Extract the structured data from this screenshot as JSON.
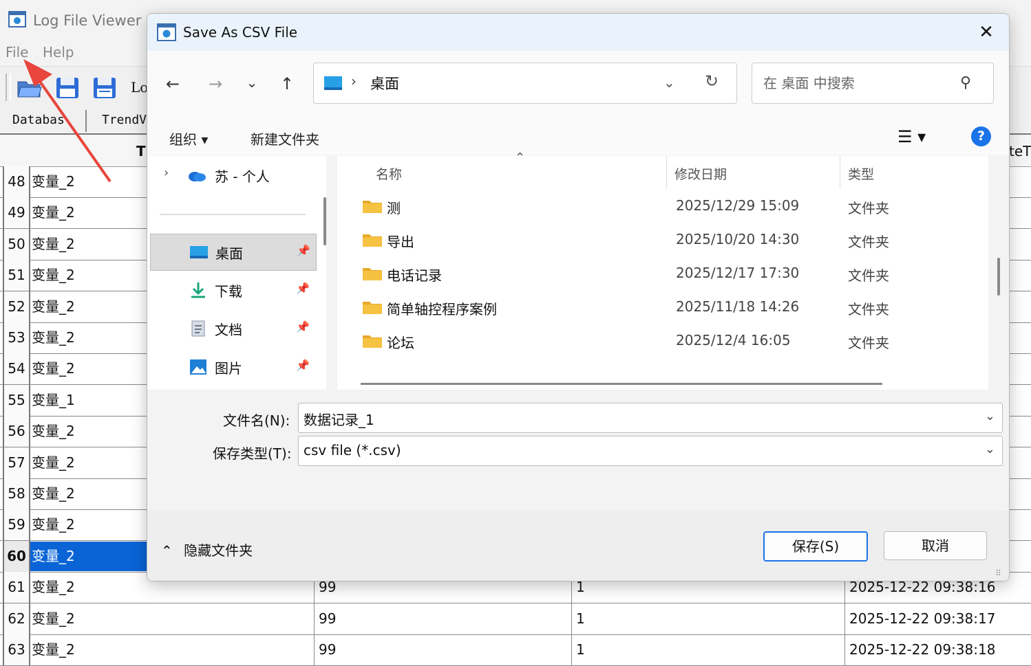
{
  "app": {
    "title": "Log File Viewer",
    "menu": [
      "File",
      "Help"
    ],
    "toolbar_text": "Lo",
    "tabs": [
      "Databas",
      "TrendV"
    ],
    "grid_header_partial": "T",
    "grid_header_right": "teT",
    "rows": [
      {
        "num": "48",
        "name": "变量_2"
      },
      {
        "num": "49",
        "name": "变量_2"
      },
      {
        "num": "50",
        "name": "变量_2"
      },
      {
        "num": "51",
        "name": "变量_2"
      },
      {
        "num": "52",
        "name": "变量_2"
      },
      {
        "num": "53",
        "name": "变量_2"
      },
      {
        "num": "54",
        "name": "变量_2"
      },
      {
        "num": "55",
        "name": "变量_1"
      },
      {
        "num": "56",
        "name": "变量_2"
      },
      {
        "num": "57",
        "name": "变量_2"
      },
      {
        "num": "58",
        "name": "变量_2"
      },
      {
        "num": "59",
        "name": "变量_2"
      },
      {
        "num": "60",
        "name": "变量_2",
        "selected": true
      },
      {
        "num": "61",
        "name": "变量_2",
        "value": "99",
        "quality": "1",
        "time": "2025-12-22 09:38:16"
      },
      {
        "num": "62",
        "name": "变量_2",
        "value": "99",
        "quality": "1",
        "time": "2025-12-22 09:38:17"
      },
      {
        "num": "63",
        "name": "变量_2",
        "value": "99",
        "quality": "1",
        "time": "2025-12-22 09:38:18"
      }
    ]
  },
  "dialog": {
    "title": "Save As CSV File",
    "close_symbol": "✕",
    "address": {
      "location": "桌面"
    },
    "search": {
      "placeholder": "在 桌面 中搜索"
    },
    "commands": {
      "organize": "组织 ▾",
      "new_folder": "新建文件夹"
    },
    "help_symbol": "?",
    "nav": {
      "cloud": "苏 - 个人",
      "items": [
        {
          "label": "桌面",
          "selected": true
        },
        {
          "label": "下载"
        },
        {
          "label": "文档"
        },
        {
          "label": "图片"
        }
      ]
    },
    "columns": {
      "name": "名称",
      "date": "修改日期",
      "type": "类型"
    },
    "files": [
      {
        "name": "测",
        "date": "2025/12/29 15:09",
        "type": "文件夹"
      },
      {
        "name": "导出",
        "date": "2025/10/20 14:30",
        "type": "文件夹"
      },
      {
        "name": "电话记录",
        "date": "2025/12/17 17:30",
        "type": "文件夹"
      },
      {
        "name": "简单轴控程序案例",
        "date": "2025/11/18 14:26",
        "type": "文件夹"
      },
      {
        "name": "论坛",
        "date": "2025/12/4 16:05",
        "type": "文件夹"
      }
    ],
    "filename_label": "文件名(N):",
    "filename_value": "数据记录_1",
    "filetype_label": "保存类型(T):",
    "filetype_value": "csv file (*.csv)",
    "hide_folders": "隐藏文件夹",
    "save_button": "保存(S)",
    "cancel_button": "取消"
  },
  "colors": {
    "accent": "#1a73e8",
    "selection": "#0a64d6",
    "arrow": "#e8453c",
    "folder": "#f5c242"
  }
}
